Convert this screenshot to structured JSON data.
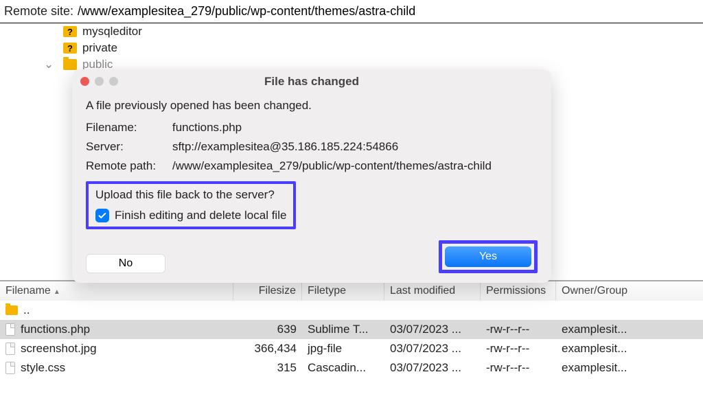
{
  "remote_bar": {
    "label": "Remote site:",
    "path": "/www/examplesitea_279/public/wp-content/themes/astra-child"
  },
  "tree": {
    "items": [
      {
        "name": "mysqleditor",
        "question": true
      },
      {
        "name": "private",
        "question": true
      },
      {
        "name": "public",
        "question": false,
        "expanded": true
      }
    ]
  },
  "dialog": {
    "title": "File has changed",
    "message": "A file previously opened has been changed.",
    "filename_label": "Filename:",
    "filename_value": "functions.php",
    "server_label": "Server:",
    "server_value": "sftp://examplesitea@35.186.185.224:54866",
    "remote_label": "Remote path:",
    "remote_value": "/www/examplesitea_279/public/wp-content/themes/astra-child",
    "prompt": "Upload this file back to the server?",
    "checkbox_label": "Finish editing and delete local file",
    "checkbox_checked": true,
    "no_label": "No",
    "yes_label": "Yes"
  },
  "listing": {
    "columns": {
      "filename": "Filename",
      "filesize": "Filesize",
      "filetype": "Filetype",
      "lastmod": "Last modified",
      "permissions": "Permissions",
      "owner": "Owner/Group"
    },
    "parent_row": "..",
    "rows": [
      {
        "name": "functions.php",
        "size": "639",
        "type": "Sublime T...",
        "mod": "03/07/2023 ...",
        "perm": "-rw-r--r--",
        "own": "examplesit...",
        "selected": true
      },
      {
        "name": "screenshot.jpg",
        "size": "366,434",
        "type": "jpg-file",
        "mod": "03/07/2023 ...",
        "perm": "-rw-r--r--",
        "own": "examplesit..."
      },
      {
        "name": "style.css",
        "size": "315",
        "type": "Cascadin...",
        "mod": "03/07/2023 ...",
        "perm": "-rw-r--r--",
        "own": "examplesit..."
      }
    ]
  }
}
